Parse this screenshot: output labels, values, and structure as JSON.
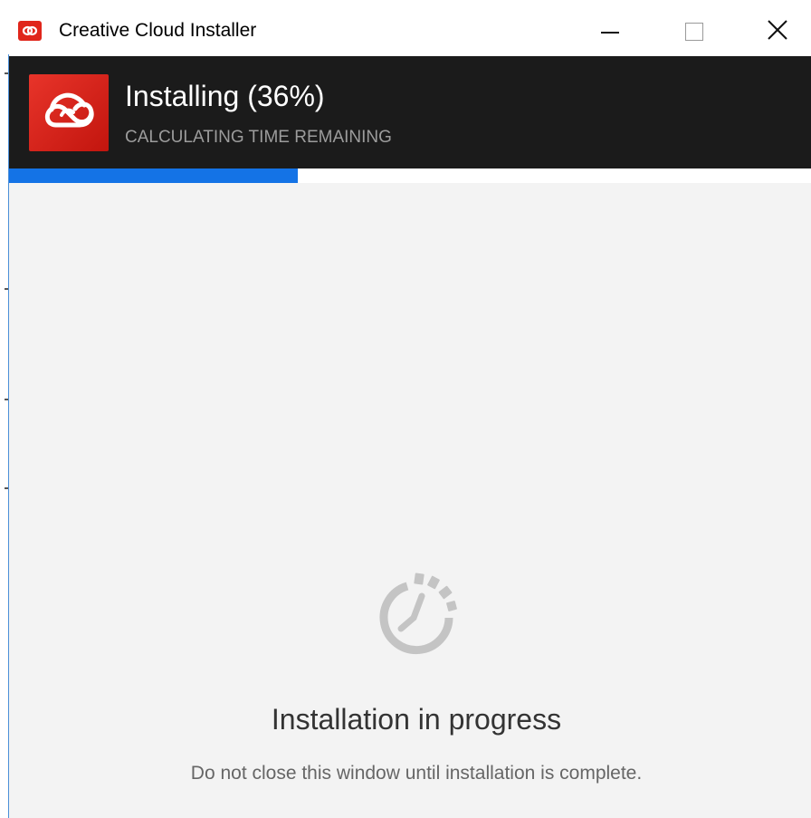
{
  "window": {
    "title": "Creative Cloud Installer",
    "icon": "creative-cloud-icon"
  },
  "header": {
    "status_title": "Installing (36%)",
    "status_subtitle": "CALCULATING TIME REMAINING",
    "logo": "creative-cloud-logo"
  },
  "progress": {
    "percent": 36,
    "color": "#1473e6"
  },
  "main": {
    "icon": "clock-progress-icon",
    "title": "Installation in progress",
    "subtitle": "Do not close this window until installation is complete."
  },
  "colors": {
    "header_bg": "#1b1b1b",
    "brand_red": "#e0261b",
    "body_bg": "#f3f3f3"
  }
}
